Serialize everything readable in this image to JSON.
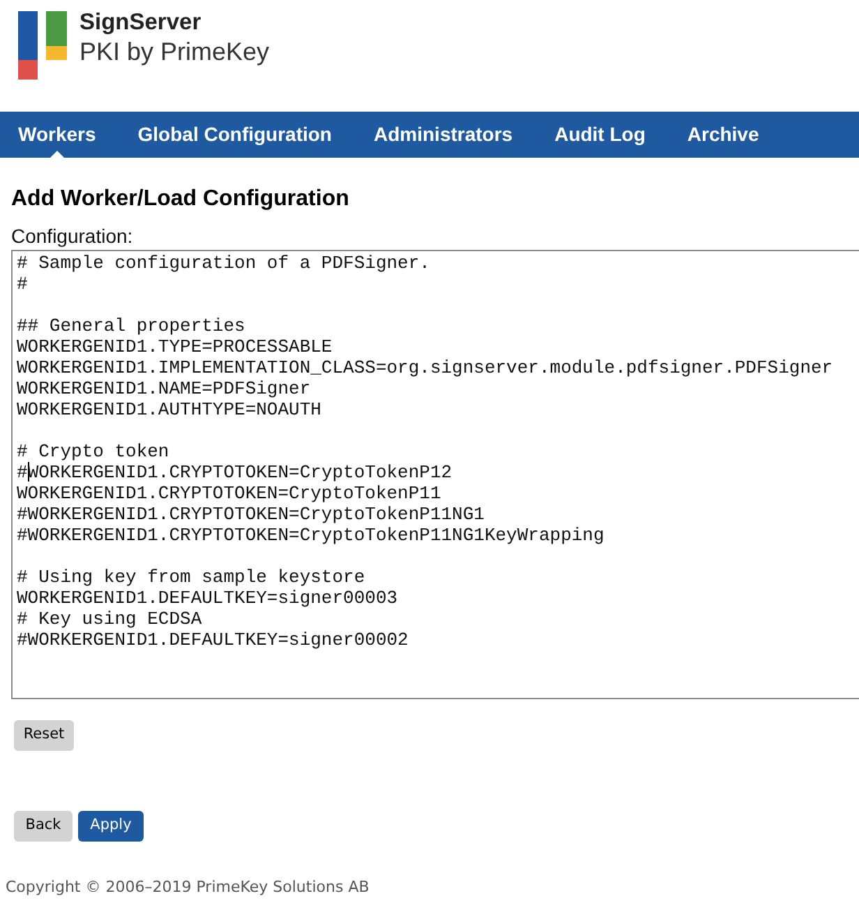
{
  "header": {
    "logo_title": "SignServer",
    "logo_subtitle": "PKI by PrimeKey"
  },
  "nav": [
    {
      "label": "Workers",
      "selected": true
    },
    {
      "label": "Global Configuration",
      "selected": false
    },
    {
      "label": "Administrators",
      "selected": false
    },
    {
      "label": "Audit Log",
      "selected": false
    },
    {
      "label": "Archive",
      "selected": false
    }
  ],
  "page": {
    "title": "Add Worker/Load Configuration",
    "configuration": {
      "label": "Configuration:",
      "blocks": [
        [
          "# Sample configuration of a PDFSigner.",
          "#"
        ],
        [
          "## General properties",
          "WORKERGENID1.TYPE=PROCESSABLE",
          "WORKERGENID1.IMPLEMENTATION_CLASS=org.signserver.module.pdfsigner.PDFSigner",
          "WORKERGENID1.NAME=PDFSigner",
          "WORKERGENID1.AUTHTYPE=NOAUTH"
        ],
        [
          "# Crypto token",
          {
            "before_caret": "#",
            "after_caret": "WORKERGENID1.CRYPTOTOKEN=CryptoTokenP12"
          },
          "WORKERGENID1.CRYPTOTOKEN=CryptoTokenP11",
          "#WORKERGENID1.CRYPTOTOKEN=CryptoTokenP11NG1",
          "#WORKERGENID1.CRYPTOTOKEN=CryptoTokenP11NG1KeyWrapping"
        ],
        [
          "# Using key from sample keystore",
          "WORKERGENID1.DEFAULTKEY=signer00003",
          "# Key using ECDSA",
          "#WORKERGENID1.DEFAULTKEY=signer00002"
        ]
      ]
    },
    "reset_button": {
      "label": "Reset",
      "kind": "secondary"
    },
    "buttons": [
      {
        "label": "Back",
        "kind": "secondary"
      },
      {
        "label": "Apply",
        "kind": "primary"
      }
    ]
  },
  "footer": {
    "copyright": "Copyright © 2006–2019 PrimeKey Solutions AB"
  }
}
